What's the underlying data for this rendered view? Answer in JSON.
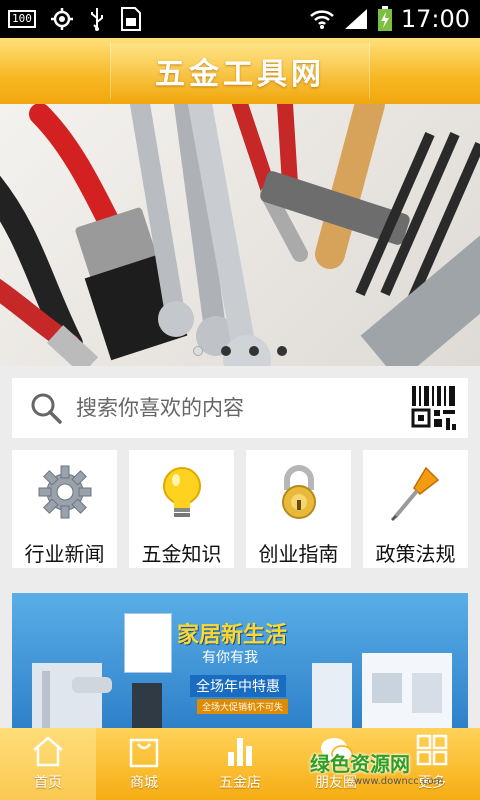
{
  "status_bar": {
    "left_icons": [
      "battery-100-icon",
      "gps-icon",
      "usb-icon",
      "sim-icon"
    ],
    "battery_box": "100",
    "right_icons": [
      "wifi-icon",
      "signal-icon",
      "battery-charging-icon"
    ],
    "time": "17:00"
  },
  "header": {
    "title": "五金工具网"
  },
  "banner": {
    "pages": 4,
    "active_index": 0
  },
  "search": {
    "placeholder": "搜索你喜欢的内容",
    "icon": "search-icon",
    "scan_icon": "qr-scan-icon"
  },
  "categories": [
    {
      "label": "行业新闻",
      "icon": "gear-icon"
    },
    {
      "label": "五金知识",
      "icon": "lightbulb-icon"
    },
    {
      "label": "创业指南",
      "icon": "padlock-icon"
    },
    {
      "label": "政策法规",
      "icon": "screwdriver-icon"
    }
  ],
  "ad": {
    "headline": "家居新生活",
    "subline": "有你有我",
    "promo": "全场年中特惠",
    "tag": "全场大促销机不可失"
  },
  "bottom_nav": [
    {
      "label": "首页",
      "icon": "home-icon",
      "active": true
    },
    {
      "label": "商城",
      "icon": "bag-icon",
      "active": false
    },
    {
      "label": "五金店",
      "icon": "bar-chart-icon",
      "active": false
    },
    {
      "label": "朋友圈",
      "icon": "chat-bubble-icon",
      "active": false
    },
    {
      "label": "更多",
      "icon": "grid-icon",
      "active": false
    }
  ],
  "watermark": {
    "text": "绿色资源网",
    "url": "www.downcc.com"
  },
  "colors": {
    "accent": "#f6ad12",
    "title_text": "#ffffff",
    "ad_yellow": "#ffd82e"
  }
}
